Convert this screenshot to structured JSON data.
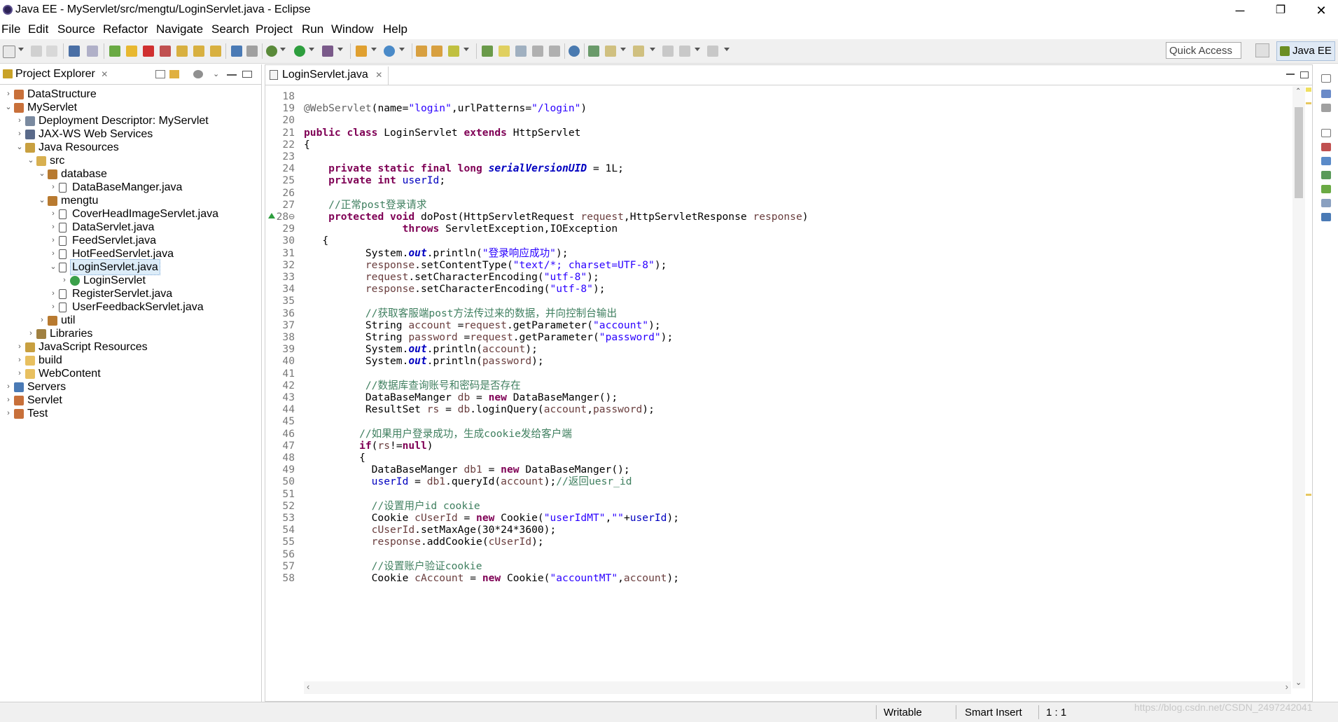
{
  "window": {
    "title": "Java EE - MyServlet/src/mengtu/LoginServlet.java - Eclipse",
    "minimize": "─",
    "restore": "❐",
    "close": "✕"
  },
  "menu": [
    "File",
    "Edit",
    "Source",
    "Refactor",
    "Navigate",
    "Search",
    "Project",
    "Run",
    "Window",
    "Help"
  ],
  "toolbar": {
    "quick_access": "Quick Access",
    "perspective": "Java EE"
  },
  "project_explorer": {
    "tab_label": "Project Explorer",
    "close": "✕",
    "tree": [
      {
        "label": "DataStructure",
        "depth": 0,
        "expand": "›",
        "icon": "project-icon"
      },
      {
        "label": "MyServlet",
        "depth": 0,
        "expand": "⌄",
        "icon": "project-icon"
      },
      {
        "label": "Deployment Descriptor: MyServlet",
        "depth": 1,
        "expand": "›",
        "icon": "descriptor-icon"
      },
      {
        "label": "JAX-WS Web Services",
        "depth": 1,
        "expand": "›",
        "icon": "webservice-icon"
      },
      {
        "label": "Java Resources",
        "depth": 1,
        "expand": "⌄",
        "icon": "java-resources-icon"
      },
      {
        "label": "src",
        "depth": 2,
        "expand": "⌄",
        "icon": "source-folder-icon"
      },
      {
        "label": "database",
        "depth": 3,
        "expand": "⌄",
        "icon": "package-icon"
      },
      {
        "label": "DataBaseManger.java",
        "depth": 4,
        "expand": "›",
        "icon": "java-file-icon"
      },
      {
        "label": "mengtu",
        "depth": 3,
        "expand": "⌄",
        "icon": "package-icon"
      },
      {
        "label": "CoverHeadImageServlet.java",
        "depth": 4,
        "expand": "›",
        "icon": "java-file-icon"
      },
      {
        "label": "DataServlet.java",
        "depth": 4,
        "expand": "›",
        "icon": "java-file-icon"
      },
      {
        "label": "FeedServlet.java",
        "depth": 4,
        "expand": "›",
        "icon": "java-file-icon"
      },
      {
        "label": "HotFeedServlet.java",
        "depth": 4,
        "expand": "›",
        "icon": "java-file-icon"
      },
      {
        "label": "LoginServlet.java",
        "depth": 4,
        "expand": "⌄",
        "icon": "java-file-icon",
        "selected": true
      },
      {
        "label": "LoginServlet",
        "depth": 5,
        "expand": "›",
        "icon": "class-icon"
      },
      {
        "label": "RegisterServlet.java",
        "depth": 4,
        "expand": "›",
        "icon": "java-file-icon"
      },
      {
        "label": "UserFeedbackServlet.java",
        "depth": 4,
        "expand": "›",
        "icon": "java-file-icon"
      },
      {
        "label": "util",
        "depth": 3,
        "expand": "›",
        "icon": "package-icon"
      },
      {
        "label": "Libraries",
        "depth": 2,
        "expand": "›",
        "icon": "libraries-icon"
      },
      {
        "label": "JavaScript Resources",
        "depth": 1,
        "expand": "›",
        "icon": "js-resources-icon"
      },
      {
        "label": "build",
        "depth": 1,
        "expand": "›",
        "icon": "folder-icon"
      },
      {
        "label": "WebContent",
        "depth": 1,
        "expand": "›",
        "icon": "folder-icon"
      },
      {
        "label": "Servers",
        "depth": 0,
        "expand": "›",
        "icon": "servers-icon"
      },
      {
        "label": "Servlet",
        "depth": 0,
        "expand": "›",
        "icon": "project-icon"
      },
      {
        "label": "Test",
        "depth": 0,
        "expand": "›",
        "icon": "project-icon"
      }
    ]
  },
  "editor": {
    "tab_label": "LoginServlet.java",
    "close": "✕",
    "lines": [
      {
        "n": "18",
        "code": []
      },
      {
        "n": "19",
        "code": [
          [
            "ann",
            "@WebServlet"
          ],
          [
            "",
            "(name="
          ],
          [
            "str",
            "\"login\""
          ],
          [
            "",
            ",urlPatterns="
          ],
          [
            "str",
            "\"/login\""
          ],
          [
            "",
            ")"
          ]
        ]
      },
      {
        "n": "20",
        "code": []
      },
      {
        "n": "21",
        "code": [
          [
            "kw",
            "public class"
          ],
          [
            "",
            " LoginServlet "
          ],
          [
            "kw",
            "extends"
          ],
          [
            "",
            " HttpServlet"
          ]
        ]
      },
      {
        "n": "22",
        "code": [
          [
            "",
            "{"
          ]
        ]
      },
      {
        "n": "23",
        "code": []
      },
      {
        "n": "24",
        "code": [
          [
            "",
            "    "
          ],
          [
            "kw",
            "private static final long"
          ],
          [
            "",
            " "
          ],
          [
            "fld",
            "serialVersionUID"
          ],
          [
            "",
            " = 1L;"
          ]
        ]
      },
      {
        "n": "25",
        "code": [
          [
            "",
            "    "
          ],
          [
            "kw",
            "private int"
          ],
          [
            "",
            " "
          ],
          [
            "fld2",
            "userId"
          ],
          [
            "",
            ";"
          ]
        ]
      },
      {
        "n": "26",
        "code": []
      },
      {
        "n": "27",
        "code": [
          [
            "",
            "    "
          ],
          [
            "cmt",
            "//正常post登录请求"
          ]
        ]
      },
      {
        "n": "28⊖",
        "code": [
          [
            "",
            "    "
          ],
          [
            "kw",
            "protected void"
          ],
          [
            "",
            " doPost(HttpServletRequest "
          ],
          [
            "var",
            "request"
          ],
          [
            "",
            ",HttpServletResponse "
          ],
          [
            "var",
            "response"
          ],
          [
            "",
            ")"
          ]
        ]
      },
      {
        "n": "29",
        "code": [
          [
            "",
            "                "
          ],
          [
            "kw",
            "throws"
          ],
          [
            "",
            " ServletException,IOException"
          ]
        ]
      },
      {
        "n": "30",
        "code": [
          [
            "",
            "   {"
          ]
        ]
      },
      {
        "n": "31",
        "code": [
          [
            "",
            "          System."
          ],
          [
            "fld",
            "out"
          ],
          [
            "",
            ".println("
          ],
          [
            "str",
            "\"登录响应成功\""
          ],
          [
            "",
            ");"
          ]
        ]
      },
      {
        "n": "32",
        "code": [
          [
            "",
            "          "
          ],
          [
            "var",
            "response"
          ],
          [
            "",
            ".setContentType("
          ],
          [
            "str",
            "\"text/*; charset=UTF-8\""
          ],
          [
            "",
            ");"
          ]
        ]
      },
      {
        "n": "33",
        "code": [
          [
            "",
            "          "
          ],
          [
            "var",
            "request"
          ],
          [
            "",
            ".setCharacterEncoding("
          ],
          [
            "str",
            "\"utf-8\""
          ],
          [
            "",
            ");"
          ]
        ]
      },
      {
        "n": "34",
        "code": [
          [
            "",
            "          "
          ],
          [
            "var",
            "response"
          ],
          [
            "",
            ".setCharacterEncoding("
          ],
          [
            "str",
            "\"utf-8\""
          ],
          [
            "",
            ");"
          ]
        ]
      },
      {
        "n": "35",
        "code": []
      },
      {
        "n": "36",
        "code": [
          [
            "",
            "          "
          ],
          [
            "cmt",
            "//获取客服端post方法传过来的数据，并向控制台输出"
          ]
        ]
      },
      {
        "n": "37",
        "code": [
          [
            "",
            "          String "
          ],
          [
            "var",
            "account"
          ],
          [
            "",
            " ="
          ],
          [
            "var",
            "request"
          ],
          [
            "",
            ".getParameter("
          ],
          [
            "str",
            "\"account\""
          ],
          [
            "",
            ");"
          ]
        ]
      },
      {
        "n": "38",
        "code": [
          [
            "",
            "          String "
          ],
          [
            "var",
            "password"
          ],
          [
            "",
            " ="
          ],
          [
            "var",
            "request"
          ],
          [
            "",
            ".getParameter("
          ],
          [
            "str",
            "\"password\""
          ],
          [
            "",
            ");"
          ]
        ]
      },
      {
        "n": "39",
        "code": [
          [
            "",
            "          System."
          ],
          [
            "fld",
            "out"
          ],
          [
            "",
            ".println("
          ],
          [
            "var",
            "account"
          ],
          [
            "",
            ");"
          ]
        ]
      },
      {
        "n": "40",
        "code": [
          [
            "",
            "          System."
          ],
          [
            "fld",
            "out"
          ],
          [
            "",
            ".println("
          ],
          [
            "var",
            "password"
          ],
          [
            "",
            ");"
          ]
        ]
      },
      {
        "n": "41",
        "code": []
      },
      {
        "n": "42",
        "code": [
          [
            "",
            "          "
          ],
          [
            "cmt",
            "//数据库查询账号和密码是否存在"
          ]
        ]
      },
      {
        "n": "43",
        "code": [
          [
            "",
            "          DataBaseManger "
          ],
          [
            "var",
            "db"
          ],
          [
            "",
            " = "
          ],
          [
            "kw",
            "new"
          ],
          [
            "",
            " DataBaseManger();"
          ]
        ]
      },
      {
        "n": "44",
        "code": [
          [
            "",
            "          ResultSet "
          ],
          [
            "var",
            "rs"
          ],
          [
            "",
            " = "
          ],
          [
            "var",
            "db"
          ],
          [
            "",
            ".loginQuery("
          ],
          [
            "var",
            "account"
          ],
          [
            "",
            ","
          ],
          [
            "var",
            "password"
          ],
          [
            "",
            ");"
          ]
        ]
      },
      {
        "n": "45",
        "code": []
      },
      {
        "n": "46",
        "code": [
          [
            "",
            "         "
          ],
          [
            "cmt",
            "//如果用户登录成功，生成cookie发给客户端"
          ]
        ]
      },
      {
        "n": "47",
        "code": [
          [
            "",
            "         "
          ],
          [
            "kw",
            "if"
          ],
          [
            "",
            "("
          ],
          [
            "var",
            "rs"
          ],
          [
            "",
            "!="
          ],
          [
            "kw",
            "null"
          ],
          [
            "",
            ")"
          ]
        ]
      },
      {
        "n": "48",
        "code": [
          [
            "",
            "         {"
          ]
        ]
      },
      {
        "n": "49",
        "code": [
          [
            "",
            "           DataBaseManger "
          ],
          [
            "var",
            "db1"
          ],
          [
            "",
            " = "
          ],
          [
            "kw",
            "new"
          ],
          [
            "",
            " DataBaseManger();"
          ]
        ]
      },
      {
        "n": "50",
        "code": [
          [
            "",
            "           "
          ],
          [
            "fld2",
            "userId"
          ],
          [
            "",
            " = "
          ],
          [
            "var",
            "db1"
          ],
          [
            "",
            ".queryId("
          ],
          [
            "var",
            "account"
          ],
          [
            "",
            ");"
          ],
          [
            "cmt",
            "//返回uesr_id"
          ]
        ]
      },
      {
        "n": "51",
        "code": []
      },
      {
        "n": "52",
        "code": [
          [
            "",
            "           "
          ],
          [
            "cmt",
            "//设置用户id cookie"
          ]
        ]
      },
      {
        "n": "53",
        "code": [
          [
            "",
            "           Cookie "
          ],
          [
            "var",
            "cUserId"
          ],
          [
            "",
            " = "
          ],
          [
            "kw",
            "new"
          ],
          [
            "",
            " Cookie("
          ],
          [
            "str",
            "\"userIdMT\""
          ],
          [
            "",
            ","
          ],
          [
            "str",
            "\"\""
          ],
          [
            "",
            "+"
          ],
          [
            "fld2",
            "userId"
          ],
          [
            "",
            ");"
          ]
        ]
      },
      {
        "n": "54",
        "code": [
          [
            "",
            "           "
          ],
          [
            "var",
            "cUserId"
          ],
          [
            "",
            ".setMaxAge(30*24*3600);"
          ]
        ]
      },
      {
        "n": "55",
        "code": [
          [
            "",
            "           "
          ],
          [
            "var",
            "response"
          ],
          [
            "",
            ".addCookie("
          ],
          [
            "var",
            "cUserId"
          ],
          [
            "",
            ");"
          ]
        ]
      },
      {
        "n": "56",
        "code": []
      },
      {
        "n": "57",
        "code": [
          [
            "",
            "           "
          ],
          [
            "cmt",
            "//设置账户验证cookie"
          ]
        ]
      },
      {
        "n": "58",
        "code": [
          [
            "",
            "           Cookie "
          ],
          [
            "var",
            "cAccount"
          ],
          [
            "",
            " = "
          ],
          [
            "kw",
            "new"
          ],
          [
            "",
            " Cookie("
          ],
          [
            "str",
            "\"accountMT\""
          ],
          [
            "",
            ","
          ],
          [
            "var",
            "account"
          ],
          [
            "",
            ");"
          ]
        ]
      }
    ]
  },
  "status": {
    "writable": "Writable",
    "insert_mode": "Smart Insert",
    "position": "1 : 1",
    "watermark": "https://blog.csdn.net/CSDN_2497242041"
  }
}
